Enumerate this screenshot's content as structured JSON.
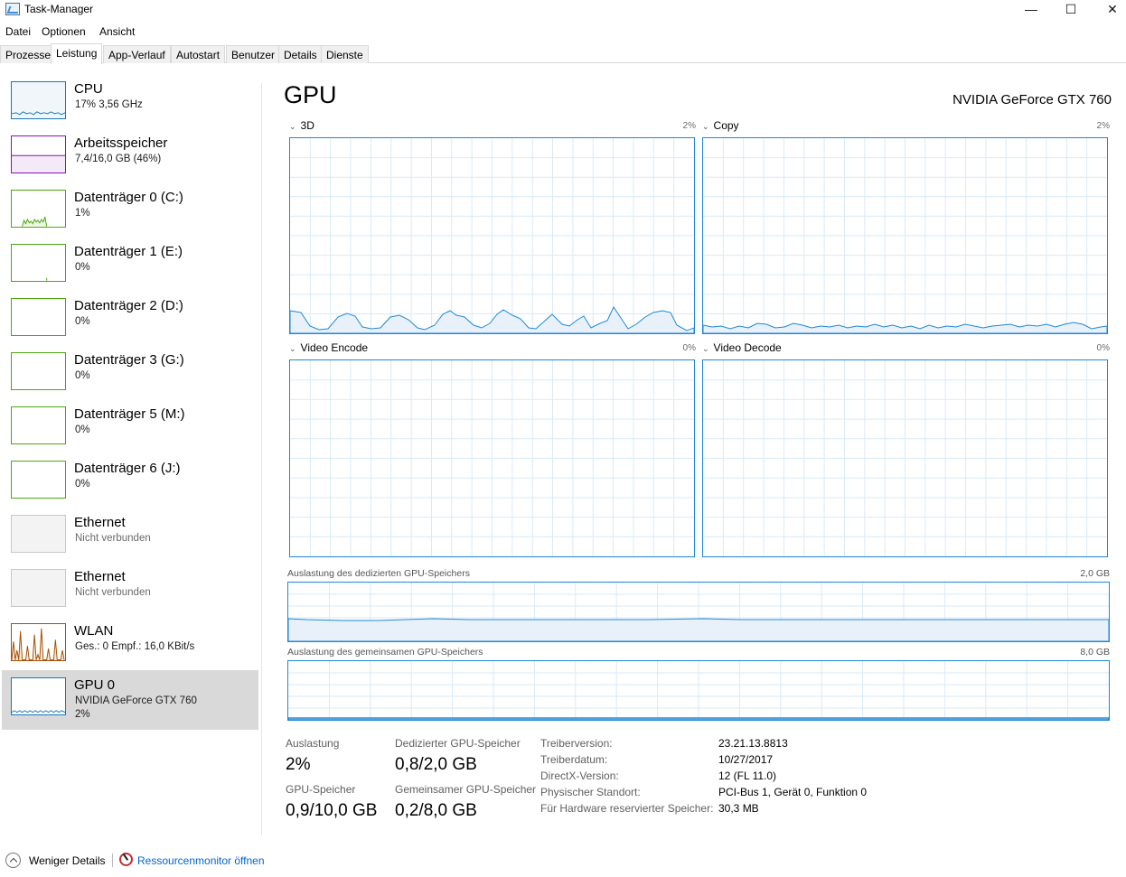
{
  "window": {
    "title": "Task-Manager",
    "minimize": "—",
    "maximize": "☐",
    "close": "✕"
  },
  "menu": [
    "Datei",
    "Optionen",
    "Ansicht"
  ],
  "tabs": [
    "Prozesse",
    "Leistung",
    "App-Verlauf",
    "Autostart",
    "Benutzer",
    "Details",
    "Dienste"
  ],
  "active_tab": "Leistung",
  "sidebar": [
    {
      "title": "CPU",
      "sub": "17% 3,56 GHz",
      "color": "#1779ba"
    },
    {
      "title": "Arbeitsspeicher",
      "sub": "7,4/16,0 GB (46%)",
      "color": "#8b12ae"
    },
    {
      "title": "Datenträger 0 (C:)",
      "sub": "1%",
      "color": "#4da60c"
    },
    {
      "title": "Datenträger 1 (E:)",
      "sub": "0%",
      "color": "#4da60c"
    },
    {
      "title": "Datenträger 2 (D:)",
      "sub": "0%",
      "color": "#4da60c"
    },
    {
      "title": "Datenträger 3 (G:)",
      "sub": "0%",
      "color": "#4da60c"
    },
    {
      "title": "Datenträger 5 (M:)",
      "sub": "0%",
      "color": "#4da60c"
    },
    {
      "title": "Datenträger 6 (J:)",
      "sub": "0%",
      "color": "#4da60c"
    },
    {
      "title": "Ethernet",
      "sub": "Nicht verbunden",
      "color": "#c8c8c8"
    },
    {
      "title": "Ethernet",
      "sub": "Nicht verbunden",
      "color": "#c8c8c8"
    },
    {
      "title": "WLAN",
      "sub": "Ges.: 0 Empf.: 16,0 KBit/s",
      "color": "#a74f01"
    },
    {
      "title": "GPU 0",
      "sub": "NVIDIA GeForce GTX 760",
      "sub2": "2%",
      "color": "#1779ba"
    }
  ],
  "main": {
    "title": "GPU",
    "device": "NVIDIA GeForce GTX 760",
    "graphs": [
      {
        "label": "3D",
        "pct": "2%"
      },
      {
        "label": "Copy",
        "pct": "2%"
      },
      {
        "label": "Video Encode",
        "pct": "0%"
      },
      {
        "label": "Video Decode",
        "pct": "0%"
      }
    ],
    "dedicated_mem_label": "Auslastung des dedizierten GPU-Speichers",
    "dedicated_mem_max": "2,0 GB",
    "shared_mem_label": "Auslastung des gemeinsamen GPU-Speichers",
    "shared_mem_max": "8,0 GB",
    "stats": {
      "usage_label": "Auslastung",
      "usage": "2%",
      "ded_label": "Dedizierter GPU-Speicher",
      "ded": "0,8/2,0 GB",
      "gpu_mem_label": "GPU-Speicher",
      "gpu_mem": "0,9/10,0 GB",
      "shared_label": "Gemeinsamer GPU-Speicher",
      "shared": "0,2/8,0 GB"
    },
    "info": [
      {
        "label": "Treiberversion:",
        "value": "23.21.13.8813"
      },
      {
        "label": "Treiberdatum:",
        "value": "10/27/2017"
      },
      {
        "label": "DirectX-Version:",
        "value": "12 (FL 11.0)"
      },
      {
        "label": "Physischer Standort:",
        "value": "PCI-Bus 1, Gerät 0, Funktion 0"
      },
      {
        "label": "Für Hardware reservierter Speicher:",
        "value": "30,3 MB"
      }
    ]
  },
  "footer": {
    "less": "Weniger Details",
    "resmon": "Ressourcenmonitor öffnen"
  },
  "colors": {
    "accent": "#1f88d6",
    "grid": "#d9eaf7",
    "fill": "#e8f1fa",
    "selected": "#d9d9d9"
  }
}
